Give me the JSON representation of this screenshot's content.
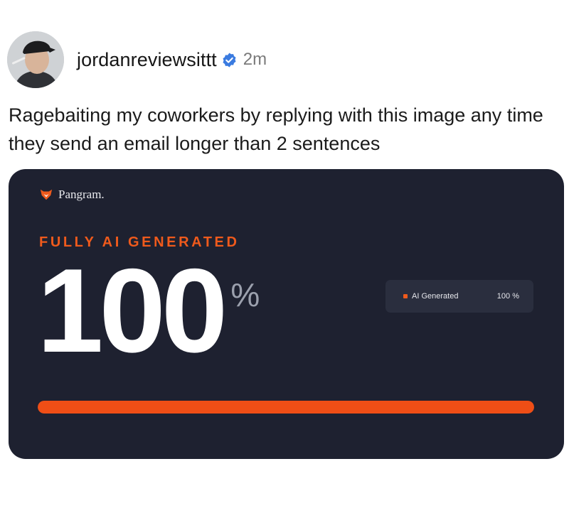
{
  "post": {
    "username": "jordanreviewsittt",
    "verified_icon": "verified-badge-icon",
    "time": "2m",
    "text": "Ragebaiting my coworkers by replying with this image any time they send an email longer than 2 sentences"
  },
  "card": {
    "brand_icon": "fox-icon",
    "brand_name": "Pangram.",
    "verdict": "FULLY AI GENERATED",
    "score": "100",
    "score_unit": "%",
    "legend_label": "AI Generated",
    "legend_value": "100 %",
    "progress_percent": 100,
    "colors": {
      "accent": "#ef5a1c",
      "card_background": "#1e2130",
      "verified": "#3a7be0"
    }
  }
}
